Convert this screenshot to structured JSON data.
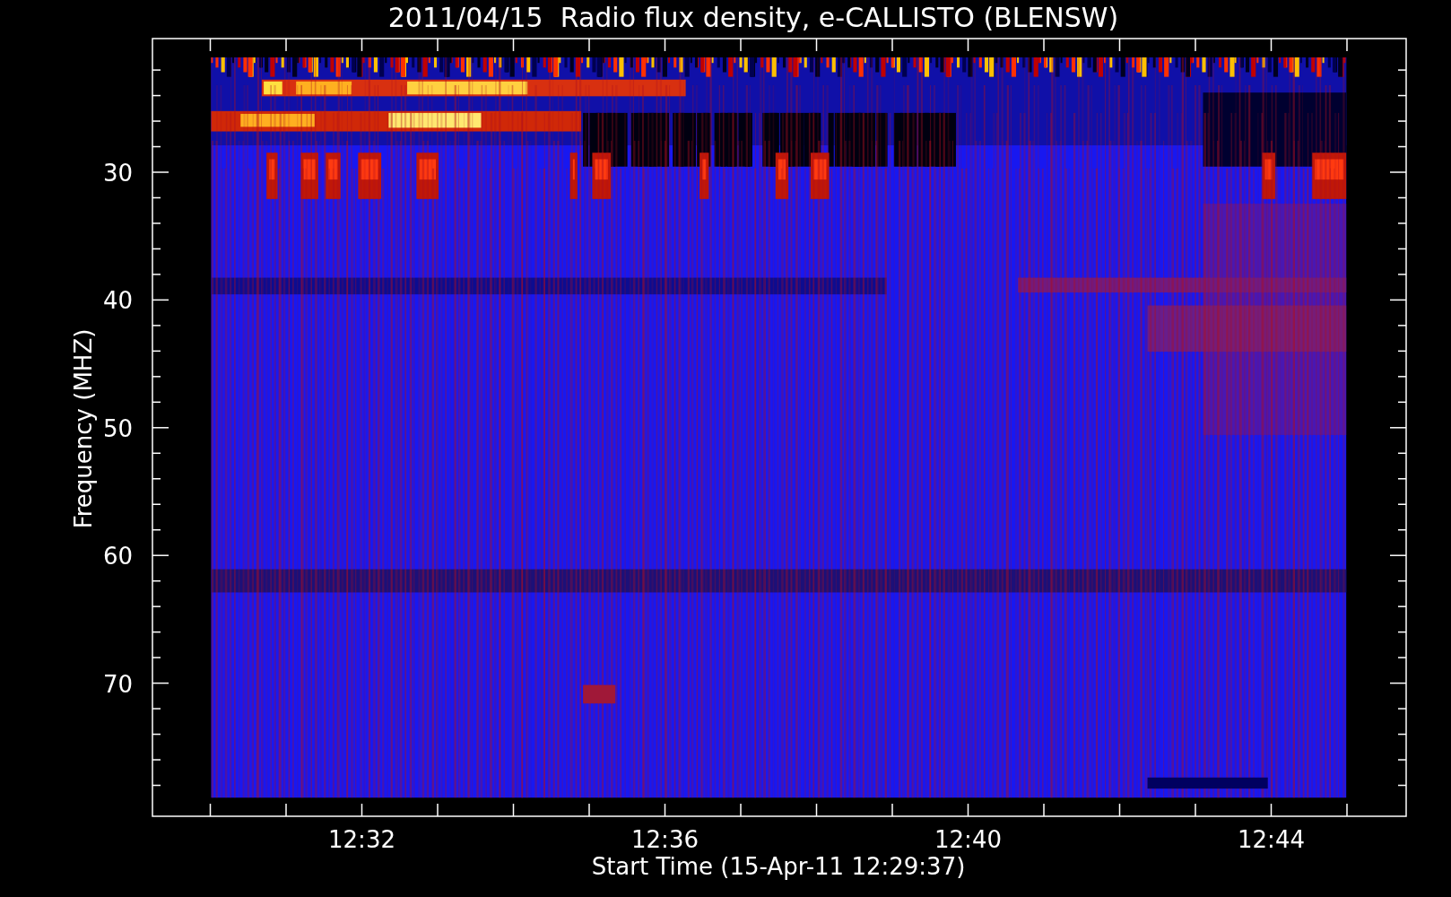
{
  "title": "2011/04/15  Radio flux density, e-CALLISTO (BLENSW)",
  "y_axis": {
    "label": "Frequency (MHZ)",
    "ticks": [
      "30",
      "40",
      "50",
      "60",
      "70"
    ]
  },
  "x_axis": {
    "label": "Start Time (15-Apr-11 12:29:37)",
    "ticks": [
      "12:32",
      "12:36",
      "12:40",
      "12:44"
    ]
  }
}
